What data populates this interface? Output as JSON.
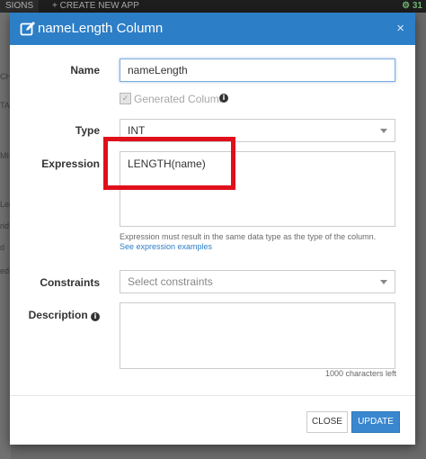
{
  "background": {
    "tab_label": "SIONS",
    "create_label": "+ CREATE NEW APP",
    "right_count": "31",
    "side_fragments": [
      "CH",
      "TA",
      "MI",
      "Ler",
      "rid",
      "d",
      "ed"
    ]
  },
  "modal": {
    "title": "nameLength Column",
    "close_label": "×",
    "fields": {
      "name": {
        "label": "Name",
        "value": "nameLength"
      },
      "generated": {
        "label": "Generated Column",
        "checked": true
      },
      "type": {
        "label": "Type",
        "value": "INT"
      },
      "expression": {
        "label": "Expression",
        "value": "LENGTH(name)",
        "help": "Expression must result in the same data type as the type of the column.",
        "link": "See expression examples"
      },
      "constraints": {
        "label": "Constraints",
        "placeholder": "Select constraints"
      },
      "description": {
        "label": "Description",
        "value": "",
        "chars_left": "1000 characters left"
      }
    },
    "buttons": {
      "close": "CLOSE",
      "update": "UPDATE"
    }
  },
  "colors": {
    "header": "#2c7ec6",
    "highlight": "#e0101b",
    "primary_button": "#3a87cf"
  },
  "icons": {
    "title": "edit-icon",
    "close": "close-icon",
    "info": "info-icon",
    "caret": "chevron-down-icon"
  }
}
